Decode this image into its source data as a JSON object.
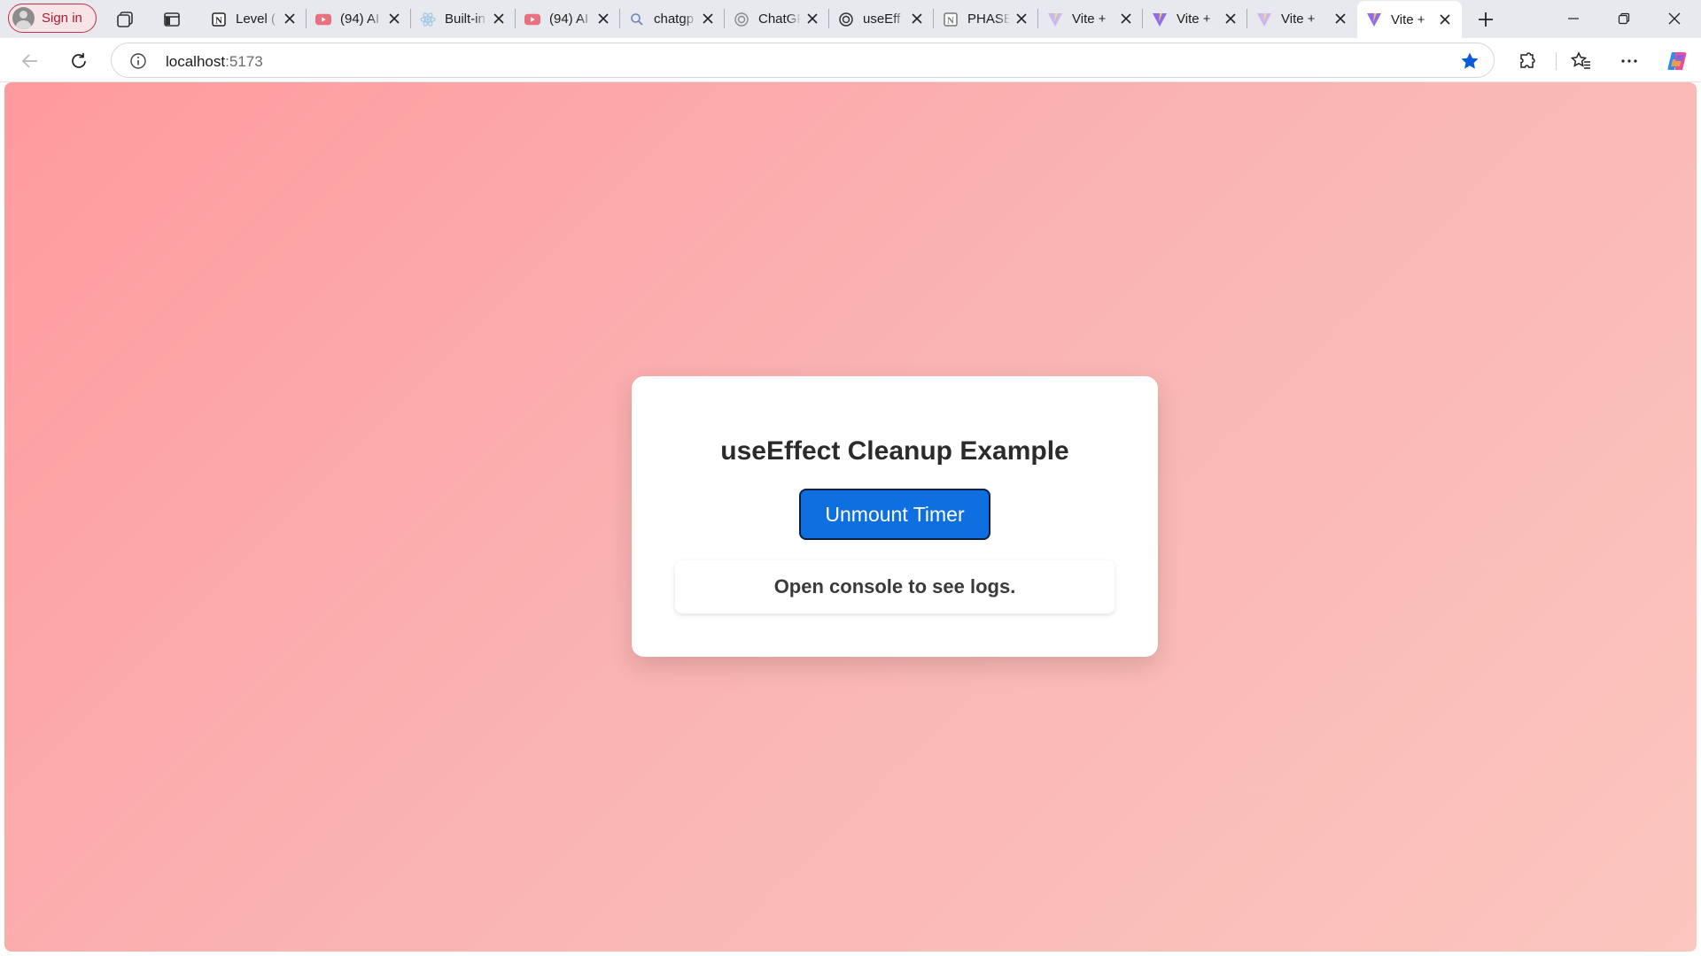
{
  "browser": {
    "sign_in_label": "Sign in",
    "tabs": [
      {
        "title": "Level (",
        "icon": "notion-icon"
      },
      {
        "title": "(94) AI",
        "icon": "youtube-icon"
      },
      {
        "title": "Built-in",
        "icon": "react-icon"
      },
      {
        "title": "(94) AI",
        "icon": "youtube-icon"
      },
      {
        "title": "chatgp",
        "icon": "search-icon"
      },
      {
        "title": "ChatGP",
        "icon": "chatgpt-icon"
      },
      {
        "title": "useEff",
        "icon": "chatgpt-icon"
      },
      {
        "title": "PHASE",
        "icon": "notion-icon"
      },
      {
        "title": "Vite +",
        "icon": "vite-icon"
      },
      {
        "title": "Vite +",
        "icon": "vite-icon"
      },
      {
        "title": "Vite +",
        "icon": "vite-icon"
      },
      {
        "title": "Vite +",
        "icon": "vite-icon",
        "active": true
      }
    ],
    "address": {
      "host": "localhost",
      "port": ":5173"
    }
  },
  "page": {
    "title": "useEffect Cleanup Example",
    "button_label": "Unmount Timer",
    "log_message": "Open console to see logs."
  },
  "colors": {
    "gradient_start": "#ff9a9e",
    "gradient_end": "#fbc6bd",
    "button_bg": "#0d6fe0",
    "sign_in_accent": "#c4314b"
  }
}
